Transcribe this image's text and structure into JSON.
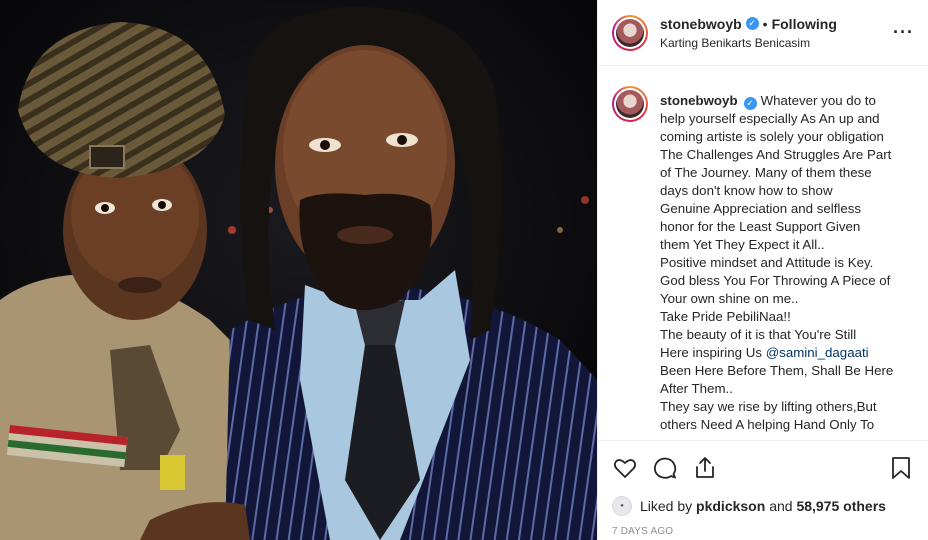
{
  "post": {
    "username": "stonebwoyb",
    "verified": true,
    "follow_status": "Following",
    "separator": "•",
    "location": "Karting Benikarts Benicasim"
  },
  "caption": {
    "username": "stonebwoyb",
    "lines": [
      "Whatever you do to",
      "help yourself especially As An up and",
      "coming artiste is solely your obligation",
      "The Challenges And Struggles Are Part",
      "of The Journey. Many of them these",
      "days don't know how to show",
      "Genuine Appreciation and selfless",
      "honor for the Least Support Given",
      "them Yet They Expect it All..",
      "Positive mindset and Attitude is Key.",
      "God bless You For Throwing A Piece of",
      "Your own shine on me..",
      "Take Pride PebiliNaa!!",
      "The beauty of it is that You're Still"
    ],
    "line_mention_prefix": "Here inspiring Us ",
    "mention": "@samini_dagaati",
    "lines_after": [
      "Been Here Before Them, Shall Be Here",
      "After Them..",
      "They say we rise by lifting others,But",
      "others Need A helping Hand Only To"
    ]
  },
  "icons": {
    "more": "more-options-icon",
    "like": "heart-icon",
    "comment": "comment-icon",
    "share": "share-icon",
    "save": "bookmark-icon",
    "verified": "verified-badge-icon"
  },
  "likes": {
    "prefix": "Liked by ",
    "user": "pkdickson",
    "middle": " and ",
    "count": "58,975 others"
  },
  "timestamp": "7 DAYS AGO",
  "colors": {
    "verified": "#3897f0",
    "mention": "#003569",
    "muted": "#8e8e8e",
    "text": "#262626"
  }
}
